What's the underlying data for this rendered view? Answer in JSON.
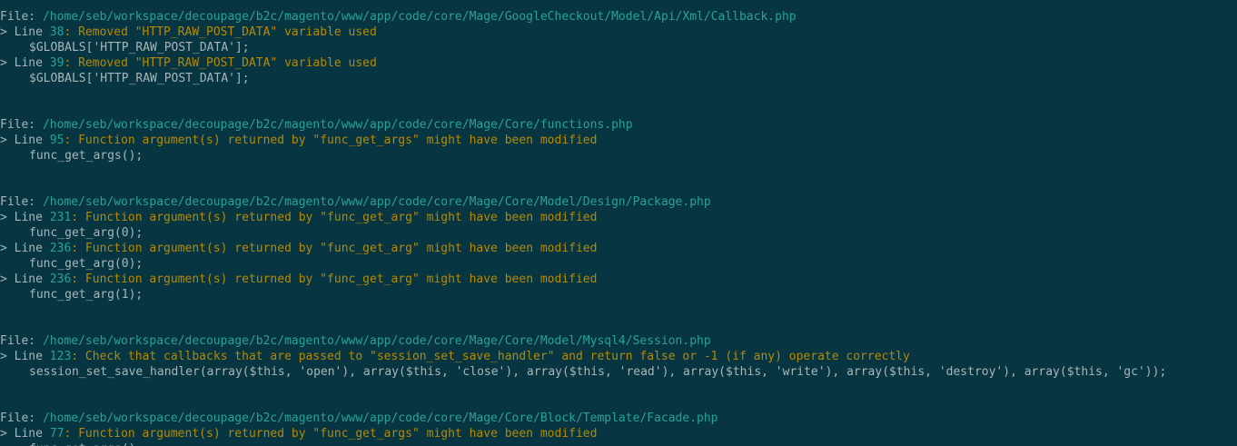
{
  "colors": {
    "background": "#073642",
    "text": "#a7b6b8",
    "path": "#2aa198",
    "message": "#b58900"
  },
  "labels": {
    "file": "File: ",
    "line": "> Line "
  },
  "entries": [
    {
      "file": "/home/seb/workspace/decoupage/b2c/magento/www/app/code/core/Mage/GoogleCheckout/Model/Api/Xml/Callback.php",
      "issues": [
        {
          "line": "38",
          "message": ": Removed \"HTTP_RAW_POST_DATA\" variable used",
          "code": "$GLOBALS['HTTP_RAW_POST_DATA'];"
        },
        {
          "line": "39",
          "message": ": Removed \"HTTP_RAW_POST_DATA\" variable used",
          "code": "$GLOBALS['HTTP_RAW_POST_DATA'];"
        }
      ]
    },
    {
      "file": "/home/seb/workspace/decoupage/b2c/magento/www/app/code/core/Mage/Core/functions.php",
      "issues": [
        {
          "line": "95",
          "message": ": Function argument(s) returned by \"func_get_args\" might have been modified",
          "code": "func_get_args();"
        }
      ]
    },
    {
      "file": "/home/seb/workspace/decoupage/b2c/magento/www/app/code/core/Mage/Core/Model/Design/Package.php",
      "issues": [
        {
          "line": "231",
          "message": ": Function argument(s) returned by \"func_get_arg\" might have been modified",
          "code": "func_get_arg(0);"
        },
        {
          "line": "236",
          "message": ": Function argument(s) returned by \"func_get_arg\" might have been modified",
          "code": "func_get_arg(0);"
        },
        {
          "line": "236",
          "message": ": Function argument(s) returned by \"func_get_arg\" might have been modified",
          "code": "func_get_arg(1);"
        }
      ]
    },
    {
      "file": "/home/seb/workspace/decoupage/b2c/magento/www/app/code/core/Mage/Core/Model/Mysql4/Session.php",
      "issues": [
        {
          "line": "123",
          "message": ": Check that callbacks that are passed to \"session_set_save_handler\" and return false or -1 (if any) operate correctly",
          "code": "session_set_save_handler(array($this, 'open'), array($this, 'close'), array($this, 'read'), array($this, 'write'), array($this, 'destroy'), array($this, 'gc'));"
        }
      ]
    },
    {
      "file": "/home/seb/workspace/decoupage/b2c/magento/www/app/code/core/Mage/Core/Block/Template/Facade.php",
      "issues": [
        {
          "line": "77",
          "message": ": Function argument(s) returned by \"func_get_args\" might have been modified",
          "code": "func_get_args();"
        }
      ]
    }
  ]
}
